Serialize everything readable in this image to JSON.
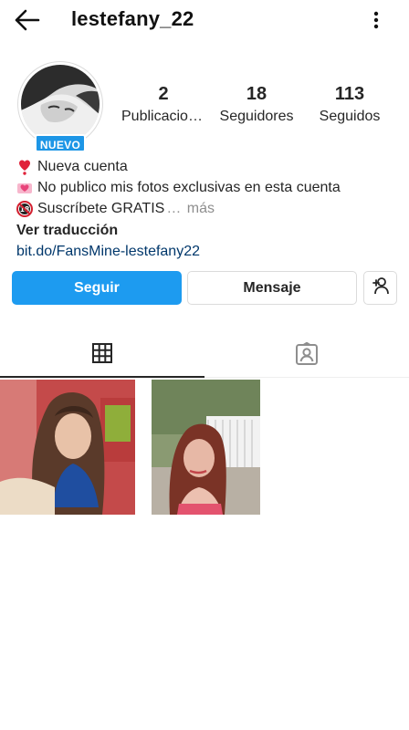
{
  "header": {
    "username": "lestefany_22",
    "back_icon": "arrow-left-icon",
    "more_icon": "more-vertical-icon"
  },
  "profile": {
    "badge": "NUEVO",
    "stats": [
      {
        "value": "2",
        "label": "Publicaciones"
      },
      {
        "value": "18",
        "label": "Seguidores"
      },
      {
        "value": "113",
        "label": "Seguidos"
      }
    ]
  },
  "bio": {
    "lines": [
      {
        "icon": "heart-exclamation-icon",
        "text": "Nueva cuenta"
      },
      {
        "icon": "heart-ribbon-icon",
        "text": "No publico mis fotos exclusivas en esta cuenta"
      },
      {
        "icon": "no-under-18-icon",
        "text": "Suscríbete GRATIS"
      }
    ],
    "truncation": "…",
    "more": "más",
    "translate": "Ver traducción",
    "link": "bit.do/FansMine-lestefany22"
  },
  "actions": {
    "follow": "Seguir",
    "message": "Mensaje",
    "add_user_icon": "add-user-icon"
  },
  "tabs": [
    {
      "icon": "grid-icon",
      "active": true
    },
    {
      "icon": "tagged-person-icon",
      "active": false
    }
  ],
  "colors": {
    "primary": "#1d9bf0",
    "badge": "#1d96e6",
    "link": "#00376b",
    "muted": "#8e8e8e"
  }
}
